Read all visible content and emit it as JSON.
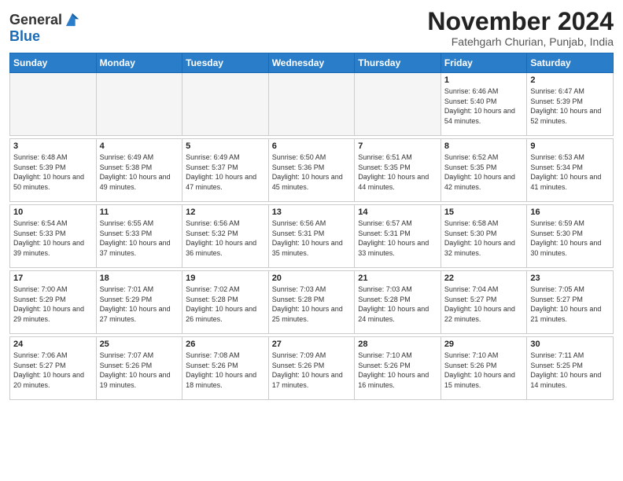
{
  "header": {
    "logo_general": "General",
    "logo_blue": "Blue",
    "month_title": "November 2024",
    "location": "Fatehgarh Churian, Punjab, India"
  },
  "weekdays": [
    "Sunday",
    "Monday",
    "Tuesday",
    "Wednesday",
    "Thursday",
    "Friday",
    "Saturday"
  ],
  "weeks": [
    [
      {
        "day": "",
        "empty": true
      },
      {
        "day": "",
        "empty": true
      },
      {
        "day": "",
        "empty": true
      },
      {
        "day": "",
        "empty": true
      },
      {
        "day": "",
        "empty": true
      },
      {
        "day": "1",
        "sunrise": "6:46 AM",
        "sunset": "5:40 PM",
        "daylight": "10 hours and 54 minutes."
      },
      {
        "day": "2",
        "sunrise": "6:47 AM",
        "sunset": "5:39 PM",
        "daylight": "10 hours and 52 minutes."
      }
    ],
    [
      {
        "day": "3",
        "sunrise": "6:48 AM",
        "sunset": "5:39 PM",
        "daylight": "10 hours and 50 minutes."
      },
      {
        "day": "4",
        "sunrise": "6:49 AM",
        "sunset": "5:38 PM",
        "daylight": "10 hours and 49 minutes."
      },
      {
        "day": "5",
        "sunrise": "6:49 AM",
        "sunset": "5:37 PM",
        "daylight": "10 hours and 47 minutes."
      },
      {
        "day": "6",
        "sunrise": "6:50 AM",
        "sunset": "5:36 PM",
        "daylight": "10 hours and 45 minutes."
      },
      {
        "day": "7",
        "sunrise": "6:51 AM",
        "sunset": "5:35 PM",
        "daylight": "10 hours and 44 minutes."
      },
      {
        "day": "8",
        "sunrise": "6:52 AM",
        "sunset": "5:35 PM",
        "daylight": "10 hours and 42 minutes."
      },
      {
        "day": "9",
        "sunrise": "6:53 AM",
        "sunset": "5:34 PM",
        "daylight": "10 hours and 41 minutes."
      }
    ],
    [
      {
        "day": "10",
        "sunrise": "6:54 AM",
        "sunset": "5:33 PM",
        "daylight": "10 hours and 39 minutes."
      },
      {
        "day": "11",
        "sunrise": "6:55 AM",
        "sunset": "5:33 PM",
        "daylight": "10 hours and 37 minutes."
      },
      {
        "day": "12",
        "sunrise": "6:56 AM",
        "sunset": "5:32 PM",
        "daylight": "10 hours and 36 minutes."
      },
      {
        "day": "13",
        "sunrise": "6:56 AM",
        "sunset": "5:31 PM",
        "daylight": "10 hours and 35 minutes."
      },
      {
        "day": "14",
        "sunrise": "6:57 AM",
        "sunset": "5:31 PM",
        "daylight": "10 hours and 33 minutes."
      },
      {
        "day": "15",
        "sunrise": "6:58 AM",
        "sunset": "5:30 PM",
        "daylight": "10 hours and 32 minutes."
      },
      {
        "day": "16",
        "sunrise": "6:59 AM",
        "sunset": "5:30 PM",
        "daylight": "10 hours and 30 minutes."
      }
    ],
    [
      {
        "day": "17",
        "sunrise": "7:00 AM",
        "sunset": "5:29 PM",
        "daylight": "10 hours and 29 minutes."
      },
      {
        "day": "18",
        "sunrise": "7:01 AM",
        "sunset": "5:29 PM",
        "daylight": "10 hours and 27 minutes."
      },
      {
        "day": "19",
        "sunrise": "7:02 AM",
        "sunset": "5:28 PM",
        "daylight": "10 hours and 26 minutes."
      },
      {
        "day": "20",
        "sunrise": "7:03 AM",
        "sunset": "5:28 PM",
        "daylight": "10 hours and 25 minutes."
      },
      {
        "day": "21",
        "sunrise": "7:03 AM",
        "sunset": "5:28 PM",
        "daylight": "10 hours and 24 minutes."
      },
      {
        "day": "22",
        "sunrise": "7:04 AM",
        "sunset": "5:27 PM",
        "daylight": "10 hours and 22 minutes."
      },
      {
        "day": "23",
        "sunrise": "7:05 AM",
        "sunset": "5:27 PM",
        "daylight": "10 hours and 21 minutes."
      }
    ],
    [
      {
        "day": "24",
        "sunrise": "7:06 AM",
        "sunset": "5:27 PM",
        "daylight": "10 hours and 20 minutes."
      },
      {
        "day": "25",
        "sunrise": "7:07 AM",
        "sunset": "5:26 PM",
        "daylight": "10 hours and 19 minutes."
      },
      {
        "day": "26",
        "sunrise": "7:08 AM",
        "sunset": "5:26 PM",
        "daylight": "10 hours and 18 minutes."
      },
      {
        "day": "27",
        "sunrise": "7:09 AM",
        "sunset": "5:26 PM",
        "daylight": "10 hours and 17 minutes."
      },
      {
        "day": "28",
        "sunrise": "7:10 AM",
        "sunset": "5:26 PM",
        "daylight": "10 hours and 16 minutes."
      },
      {
        "day": "29",
        "sunrise": "7:10 AM",
        "sunset": "5:26 PM",
        "daylight": "10 hours and 15 minutes."
      },
      {
        "day": "30",
        "sunrise": "7:11 AM",
        "sunset": "5:25 PM",
        "daylight": "10 hours and 14 minutes."
      }
    ]
  ]
}
